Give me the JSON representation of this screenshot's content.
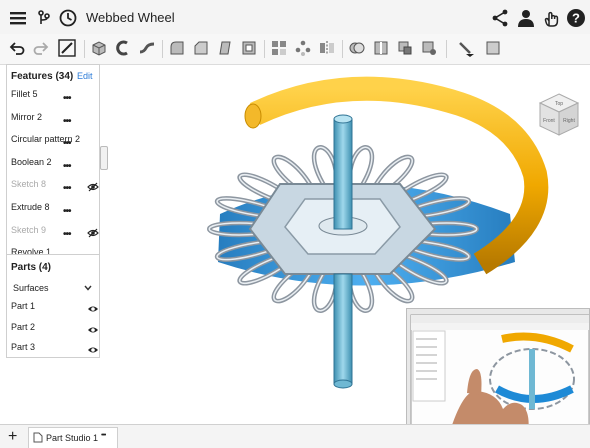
{
  "document": {
    "title": "Webbed Wheel"
  },
  "features": {
    "header": "Features (34)",
    "edit_label": "Edit",
    "items": [
      {
        "label": "Fillet 5",
        "hidden": false
      },
      {
        "label": "Mirror 2",
        "hidden": false
      },
      {
        "label": "Circular pattern 2",
        "hidden": false
      },
      {
        "label": "Boolean 2",
        "hidden": false
      },
      {
        "label": "Sketch 8",
        "hidden": true
      },
      {
        "label": "Extrude 8",
        "hidden": false
      },
      {
        "label": "Sketch 9",
        "hidden": true
      },
      {
        "label": "Revolve 1",
        "hidden": false
      }
    ]
  },
  "parts": {
    "header": "Parts (4)",
    "group_label": "Surfaces",
    "items": [
      {
        "label": "Part 1"
      },
      {
        "label": "Part 2"
      },
      {
        "label": "Part 3"
      }
    ]
  },
  "bottom": {
    "add_label": "+",
    "tab_label": "Part Studio 1",
    "tab_menu": "•••"
  },
  "view_cube": {
    "top_label": "Top",
    "front_label": "Front",
    "right_label": "Right"
  },
  "colors": {
    "accent": "#2b7bd8",
    "rim_yellow": "#f6b400",
    "hub_blue": "#1e8ad6",
    "wire_gray": "#8d96a0"
  }
}
